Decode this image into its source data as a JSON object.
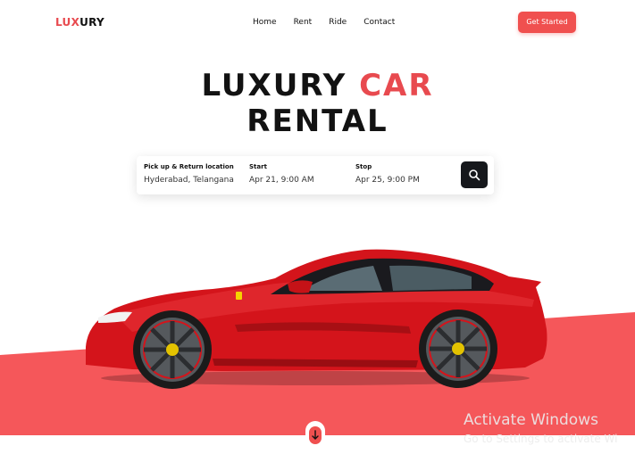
{
  "brand": {
    "part1": "LUX",
    "part2": "URY"
  },
  "nav": {
    "items": [
      "Home",
      "Rent",
      "Ride",
      "Contact"
    ],
    "cta": "Get Started"
  },
  "hero": {
    "line1_a": "LUXURY",
    "line1_b": "CAR",
    "line2": "RENTAL"
  },
  "search": {
    "fields": [
      {
        "label": "Pick up & Return location",
        "value": "Hyderabad, Telangana"
      },
      {
        "label": "Start",
        "value": "Apr 21, 9:00 AM"
      },
      {
        "label": "Stop",
        "value": "Apr 25, 9:00 PM"
      }
    ],
    "button_icon": "search-icon"
  },
  "scroll_icon": "arrow-down-icon",
  "watermark": {
    "title": "Activate Windows",
    "subtitle": "Go to Settings to activate Wi"
  },
  "colors": {
    "accent": "#f0504f",
    "dark": "#16181c",
    "text": "#121212"
  }
}
